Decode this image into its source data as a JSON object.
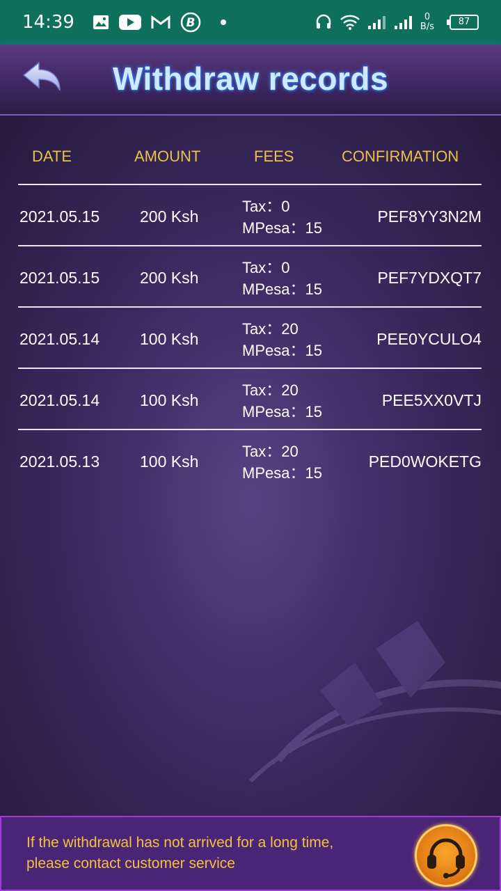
{
  "status_bar": {
    "time": "14:39",
    "net_speed_value": "0",
    "net_speed_unit": "B/s",
    "battery": "87",
    "left_icons": [
      "gallery-icon",
      "youtube-icon",
      "gmail-icon",
      "b-app-icon",
      "dot-icon"
    ],
    "right_icons": [
      "headset-icon",
      "wifi-icon",
      "signal-icon",
      "signal-icon"
    ]
  },
  "header": {
    "title": "Withdraw records"
  },
  "table": {
    "columns": [
      "DATE",
      "AMOUNT",
      "FEES",
      "CONFIRMATION"
    ],
    "rows": [
      {
        "date": "2021.05.15",
        "amount": "200 Ksh",
        "tax": "Tax：0",
        "mpesa": "MPesa：15",
        "confirmation": "PEF8YY3N2M"
      },
      {
        "date": "2021.05.15",
        "amount": "200 Ksh",
        "tax": "Tax：0",
        "mpesa": "MPesa：15",
        "confirmation": "PEF7YDXQT7"
      },
      {
        "date": "2021.05.14",
        "amount": "100 Ksh",
        "tax": "Tax：20",
        "mpesa": "MPesa：15",
        "confirmation": "PEE0YCULO4"
      },
      {
        "date": "2021.05.14",
        "amount": "100 Ksh",
        "tax": "Tax：20",
        "mpesa": "MPesa：15",
        "confirmation": "PEE5XX0VTJ"
      },
      {
        "date": "2021.05.13",
        "amount": "100 Ksh",
        "tax": "Tax：20",
        "mpesa": "MPesa：15",
        "confirmation": "PED0WOKETG"
      }
    ]
  },
  "notice": {
    "line1": "If the withdrawal has not arrived for a long time,",
    "line2": "please contact customer service"
  },
  "colors": {
    "status_bar": "#0d6f5c",
    "column_header": "#e8c24a",
    "notice_text": "#f2c33a",
    "title_glow": "#3f8cff"
  }
}
